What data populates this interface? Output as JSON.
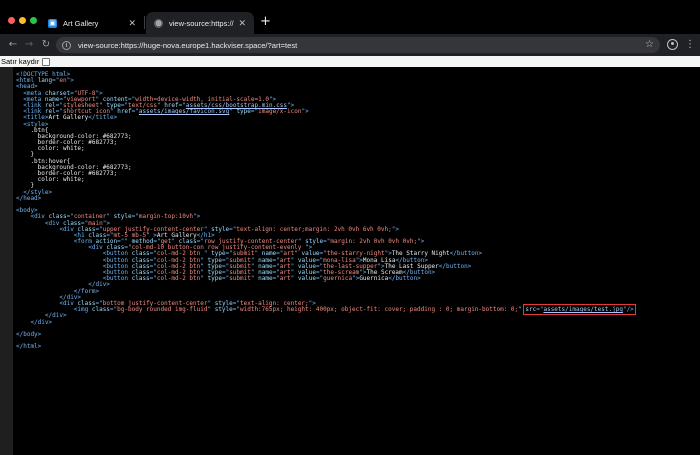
{
  "tabs": [
    {
      "title": "Art Gallery",
      "favicon": "gallery-favicon-icon",
      "close": "✕"
    },
    {
      "title": "view-source:https://huge-nova.europe1.hackviser.space/?art=test",
      "favicon": "globe-icon",
      "close": "✕"
    }
  ],
  "new_tab_label": "+",
  "address_bar": {
    "url": "view-source:https://huge-nova.europe1.hackviser.space/?art=test"
  },
  "line_wrap_label": "Satır kaydır",
  "source_lines": [
    {
      "segs": [
        {
          "c": "t",
          "s": "<!DOCTYPE html>"
        }
      ]
    },
    {
      "segs": [
        {
          "c": "t",
          "s": "<html "
        },
        {
          "c": "a",
          "s": "lang"
        },
        {
          "c": "t",
          "s": "=\""
        },
        {
          "c": "v",
          "s": "en"
        },
        {
          "c": "t",
          "s": "\">"
        }
      ]
    },
    {
      "segs": [
        {
          "c": "t",
          "s": "<head>"
        }
      ]
    },
    {
      "segs": [
        {
          "c": "tx",
          "s": "  "
        },
        {
          "c": "t",
          "s": "<meta "
        },
        {
          "c": "a",
          "s": "charset"
        },
        {
          "c": "t",
          "s": "=\""
        },
        {
          "c": "v",
          "s": "UTF-8"
        },
        {
          "c": "t",
          "s": "\">"
        }
      ]
    },
    {
      "segs": [
        {
          "c": "tx",
          "s": "  "
        },
        {
          "c": "t",
          "s": "<meta "
        },
        {
          "c": "a",
          "s": "name"
        },
        {
          "c": "t",
          "s": "=\""
        },
        {
          "c": "v",
          "s": "viewport"
        },
        {
          "c": "t",
          "s": "\" "
        },
        {
          "c": "a",
          "s": "content"
        },
        {
          "c": "t",
          "s": "=\""
        },
        {
          "c": "v",
          "s": "width=device-width, initial-scale=1.0"
        },
        {
          "c": "t",
          "s": "\">"
        }
      ]
    },
    {
      "segs": [
        {
          "c": "tx",
          "s": "  "
        },
        {
          "c": "t",
          "s": "<link "
        },
        {
          "c": "a",
          "s": "rel"
        },
        {
          "c": "t",
          "s": "=\""
        },
        {
          "c": "v",
          "s": "stylesheet"
        },
        {
          "c": "t",
          "s": "\" "
        },
        {
          "c": "a",
          "s": "type"
        },
        {
          "c": "t",
          "s": "=\""
        },
        {
          "c": "v",
          "s": "text/css"
        },
        {
          "c": "t",
          "s": "\" "
        },
        {
          "c": "a",
          "s": "href"
        },
        {
          "c": "t",
          "s": "=\""
        },
        {
          "c": "lk",
          "s": "assets/css/bootstrap.min.css"
        },
        {
          "c": "t",
          "s": "\">"
        }
      ]
    },
    {
      "segs": [
        {
          "c": "tx",
          "s": "  "
        },
        {
          "c": "t",
          "s": "<link "
        },
        {
          "c": "a",
          "s": "rel"
        },
        {
          "c": "t",
          "s": "=\""
        },
        {
          "c": "v",
          "s": "shortcut icon"
        },
        {
          "c": "t",
          "s": "\" "
        },
        {
          "c": "a",
          "s": "href"
        },
        {
          "c": "t",
          "s": "=\""
        },
        {
          "c": "lk",
          "s": "assets/images/favicon.svg"
        },
        {
          "c": "t",
          "s": "\" "
        },
        {
          "c": "a",
          "s": "type"
        },
        {
          "c": "t",
          "s": "=\""
        },
        {
          "c": "v",
          "s": "image/x-icon"
        },
        {
          "c": "t",
          "s": "\">"
        }
      ]
    },
    {
      "segs": [
        {
          "c": "tx",
          "s": "  "
        },
        {
          "c": "t",
          "s": "<title>"
        },
        {
          "c": "tx",
          "s": "Art Gallery"
        },
        {
          "c": "t",
          "s": "</title>"
        }
      ]
    },
    {
      "segs": [
        {
          "c": "tx",
          "s": "  "
        },
        {
          "c": "t",
          "s": "<style>"
        }
      ]
    },
    {
      "segs": [
        {
          "c": "tx",
          "s": "    .btn{"
        }
      ]
    },
    {
      "segs": [
        {
          "c": "tx",
          "s": "      background-color: #682773;"
        }
      ]
    },
    {
      "segs": [
        {
          "c": "tx",
          "s": "      border-color: #682773;"
        }
      ]
    },
    {
      "segs": [
        {
          "c": "tx",
          "s": "      color: white;"
        }
      ]
    },
    {
      "segs": [
        {
          "c": "tx",
          "s": "    }"
        }
      ]
    },
    {
      "segs": [
        {
          "c": "tx",
          "s": "    .btn:hover{"
        }
      ]
    },
    {
      "segs": [
        {
          "c": "tx",
          "s": "      background-color: #682773;"
        }
      ]
    },
    {
      "segs": [
        {
          "c": "tx",
          "s": "      border-color: #682773;"
        }
      ]
    },
    {
      "segs": [
        {
          "c": "tx",
          "s": "      color: white;"
        }
      ]
    },
    {
      "segs": [
        {
          "c": "tx",
          "s": "    }"
        }
      ]
    },
    {
      "segs": [
        {
          "c": "tx",
          "s": "  "
        },
        {
          "c": "t",
          "s": "</style>"
        }
      ]
    },
    {
      "segs": [
        {
          "c": "t",
          "s": "</head>"
        }
      ]
    },
    {
      "segs": []
    },
    {
      "segs": [
        {
          "c": "t",
          "s": "<body>"
        }
      ]
    },
    {
      "segs": [
        {
          "c": "tx",
          "s": "    "
        },
        {
          "c": "t",
          "s": "<div "
        },
        {
          "c": "a",
          "s": "class"
        },
        {
          "c": "t",
          "s": "=\""
        },
        {
          "c": "v",
          "s": "container"
        },
        {
          "c": "t",
          "s": "\" "
        },
        {
          "c": "a",
          "s": "style"
        },
        {
          "c": "t",
          "s": "=\""
        },
        {
          "c": "v",
          "s": "margin-top:10vh"
        },
        {
          "c": "t",
          "s": "\">"
        }
      ]
    },
    {
      "segs": [
        {
          "c": "tx",
          "s": "        "
        },
        {
          "c": "t",
          "s": "<div "
        },
        {
          "c": "a",
          "s": "class"
        },
        {
          "c": "t",
          "s": "=\""
        },
        {
          "c": "v",
          "s": "main"
        },
        {
          "c": "t",
          "s": "\">"
        }
      ]
    },
    {
      "segs": [
        {
          "c": "tx",
          "s": "            "
        },
        {
          "c": "t",
          "s": "<div "
        },
        {
          "c": "a",
          "s": "class"
        },
        {
          "c": "t",
          "s": "=\""
        },
        {
          "c": "v",
          "s": "upper justify-content-center"
        },
        {
          "c": "t",
          "s": "\" "
        },
        {
          "c": "a",
          "s": "style"
        },
        {
          "c": "t",
          "s": "=\""
        },
        {
          "c": "v",
          "s": "text-align: center;margin: 2vh 0vh 6vh 0vh;"
        },
        {
          "c": "t",
          "s": "\">"
        }
      ]
    },
    {
      "segs": [
        {
          "c": "tx",
          "s": "                "
        },
        {
          "c": "t",
          "s": "<h1 "
        },
        {
          "c": "a",
          "s": "class"
        },
        {
          "c": "t",
          "s": "=\""
        },
        {
          "c": "v",
          "s": "mt-5 mb-5"
        },
        {
          "c": "t",
          "s": "\" >"
        },
        {
          "c": "tx",
          "s": "Art Gallery"
        },
        {
          "c": "t",
          "s": "</h1>"
        }
      ]
    },
    {
      "segs": [
        {
          "c": "tx",
          "s": "                "
        },
        {
          "c": "t",
          "s": "<form "
        },
        {
          "c": "a",
          "s": "action"
        },
        {
          "c": "t",
          "s": "=\""
        },
        {
          "c": "v",
          "s": ""
        },
        {
          "c": "t",
          "s": "\" "
        },
        {
          "c": "a",
          "s": "method"
        },
        {
          "c": "t",
          "s": "=\""
        },
        {
          "c": "v",
          "s": "get"
        },
        {
          "c": "t",
          "s": "\" "
        },
        {
          "c": "a",
          "s": "class"
        },
        {
          "c": "t",
          "s": "=\""
        },
        {
          "c": "v",
          "s": "row justify-content-center"
        },
        {
          "c": "t",
          "s": "\" "
        },
        {
          "c": "a",
          "s": "style"
        },
        {
          "c": "t",
          "s": "=\""
        },
        {
          "c": "v",
          "s": "margin: 2vh 0vh 0vh 0vh;"
        },
        {
          "c": "t",
          "s": "\">"
        }
      ]
    },
    {
      "segs": [
        {
          "c": "tx",
          "s": "                    "
        },
        {
          "c": "t",
          "s": "<div "
        },
        {
          "c": "a",
          "s": "class"
        },
        {
          "c": "t",
          "s": "=\""
        },
        {
          "c": "v",
          "s": "col-md-10 button-con row justify-content-evenly "
        },
        {
          "c": "t",
          "s": "\">"
        }
      ]
    },
    {
      "segs": [
        {
          "c": "tx",
          "s": "                        "
        },
        {
          "c": "t",
          "s": "<button "
        },
        {
          "c": "a",
          "s": "class"
        },
        {
          "c": "t",
          "s": "=\""
        },
        {
          "c": "v",
          "s": "col-md-2 btn "
        },
        {
          "c": "t",
          "s": "\" "
        },
        {
          "c": "a",
          "s": "type"
        },
        {
          "c": "t",
          "s": "=\""
        },
        {
          "c": "v",
          "s": "submit"
        },
        {
          "c": "t",
          "s": "\" "
        },
        {
          "c": "a",
          "s": "name"
        },
        {
          "c": "t",
          "s": "=\""
        },
        {
          "c": "v",
          "s": "art"
        },
        {
          "c": "t",
          "s": "\" "
        },
        {
          "c": "a",
          "s": "value"
        },
        {
          "c": "t",
          "s": "=\""
        },
        {
          "c": "v",
          "s": "the-starry-night"
        },
        {
          "c": "t",
          "s": "\">"
        },
        {
          "c": "tx",
          "s": "The Starry Night"
        },
        {
          "c": "t",
          "s": "</button>"
        }
      ]
    },
    {
      "segs": [
        {
          "c": "tx",
          "s": "                        "
        },
        {
          "c": "t",
          "s": "<button "
        },
        {
          "c": "a",
          "s": "class"
        },
        {
          "c": "t",
          "s": "=\""
        },
        {
          "c": "v",
          "s": "col-md-2 btn"
        },
        {
          "c": "t",
          "s": "\" "
        },
        {
          "c": "a",
          "s": "type"
        },
        {
          "c": "t",
          "s": "=\""
        },
        {
          "c": "v",
          "s": "submit"
        },
        {
          "c": "t",
          "s": "\" "
        },
        {
          "c": "a",
          "s": "name"
        },
        {
          "c": "t",
          "s": "=\""
        },
        {
          "c": "v",
          "s": "art"
        },
        {
          "c": "t",
          "s": "\" "
        },
        {
          "c": "a",
          "s": "value"
        },
        {
          "c": "t",
          "s": "=\""
        },
        {
          "c": "v",
          "s": "mona-lisa"
        },
        {
          "c": "t",
          "s": "\">"
        },
        {
          "c": "tx",
          "s": "Mona Lisa"
        },
        {
          "c": "t",
          "s": "</button>"
        }
      ]
    },
    {
      "segs": [
        {
          "c": "tx",
          "s": "                        "
        },
        {
          "c": "t",
          "s": "<button "
        },
        {
          "c": "a",
          "s": "class"
        },
        {
          "c": "t",
          "s": "=\""
        },
        {
          "c": "v",
          "s": "col-md-2 btn"
        },
        {
          "c": "t",
          "s": "\" "
        },
        {
          "c": "a",
          "s": "type"
        },
        {
          "c": "t",
          "s": "=\""
        },
        {
          "c": "v",
          "s": "submit"
        },
        {
          "c": "t",
          "s": "\" "
        },
        {
          "c": "a",
          "s": "name"
        },
        {
          "c": "t",
          "s": "=\""
        },
        {
          "c": "v",
          "s": "art"
        },
        {
          "c": "t",
          "s": "\" "
        },
        {
          "c": "a",
          "s": "value"
        },
        {
          "c": "t",
          "s": "=\""
        },
        {
          "c": "v",
          "s": "the-last-supper"
        },
        {
          "c": "t",
          "s": "\">"
        },
        {
          "c": "tx",
          "s": "The Last Supper"
        },
        {
          "c": "t",
          "s": "</button>"
        }
      ]
    },
    {
      "segs": [
        {
          "c": "tx",
          "s": "                        "
        },
        {
          "c": "t",
          "s": "<button "
        },
        {
          "c": "a",
          "s": "class"
        },
        {
          "c": "t",
          "s": "=\""
        },
        {
          "c": "v",
          "s": "col-md-2 btn"
        },
        {
          "c": "t",
          "s": "\" "
        },
        {
          "c": "a",
          "s": "type"
        },
        {
          "c": "t",
          "s": "=\""
        },
        {
          "c": "v",
          "s": "submit"
        },
        {
          "c": "t",
          "s": "\" "
        },
        {
          "c": "a",
          "s": "name"
        },
        {
          "c": "t",
          "s": "=\""
        },
        {
          "c": "v",
          "s": "art"
        },
        {
          "c": "t",
          "s": "\" "
        },
        {
          "c": "a",
          "s": "value"
        },
        {
          "c": "t",
          "s": "=\""
        },
        {
          "c": "v",
          "s": "the-scream"
        },
        {
          "c": "t",
          "s": "\">"
        },
        {
          "c": "tx",
          "s": "The Scream"
        },
        {
          "c": "t",
          "s": "</button>"
        }
      ]
    },
    {
      "segs": [
        {
          "c": "tx",
          "s": "                        "
        },
        {
          "c": "t",
          "s": "<button "
        },
        {
          "c": "a",
          "s": "class"
        },
        {
          "c": "t",
          "s": "=\""
        },
        {
          "c": "v",
          "s": "col-md-2 btn"
        },
        {
          "c": "t",
          "s": "\" "
        },
        {
          "c": "a",
          "s": "type"
        },
        {
          "c": "t",
          "s": "=\""
        },
        {
          "c": "v",
          "s": "submit"
        },
        {
          "c": "t",
          "s": "\" "
        },
        {
          "c": "a",
          "s": "name"
        },
        {
          "c": "t",
          "s": "=\""
        },
        {
          "c": "v",
          "s": "art"
        },
        {
          "c": "t",
          "s": "\" "
        },
        {
          "c": "a",
          "s": "value"
        },
        {
          "c": "t",
          "s": "=\""
        },
        {
          "c": "v",
          "s": "guernica"
        },
        {
          "c": "t",
          "s": "\">"
        },
        {
          "c": "tx",
          "s": "Guernica"
        },
        {
          "c": "t",
          "s": "</button>"
        }
      ]
    },
    {
      "segs": [
        {
          "c": "tx",
          "s": "                    "
        },
        {
          "c": "t",
          "s": "</div>"
        }
      ]
    },
    {
      "segs": [
        {
          "c": "tx",
          "s": "                "
        },
        {
          "c": "t",
          "s": "</form>"
        }
      ]
    },
    {
      "segs": [
        {
          "c": "tx",
          "s": "            "
        },
        {
          "c": "t",
          "s": "</div>"
        }
      ]
    },
    {
      "segs": [
        {
          "c": "tx",
          "s": "            "
        },
        {
          "c": "t",
          "s": "<div "
        },
        {
          "c": "a",
          "s": "class"
        },
        {
          "c": "t",
          "s": "=\""
        },
        {
          "c": "v",
          "s": "bottom justify-content-center"
        },
        {
          "c": "t",
          "s": "\" "
        },
        {
          "c": "a",
          "s": "style"
        },
        {
          "c": "t",
          "s": "=\""
        },
        {
          "c": "v",
          "s": "text-align: center;"
        },
        {
          "c": "t",
          "s": "\">"
        }
      ]
    },
    {
      "segs": [
        {
          "c": "tx",
          "s": "                "
        },
        {
          "c": "t",
          "s": "<img "
        },
        {
          "c": "a",
          "s": "class"
        },
        {
          "c": "t",
          "s": "=\""
        },
        {
          "c": "v",
          "s": "bg-body rounded img-fluid"
        },
        {
          "c": "t",
          "s": "\" "
        },
        {
          "c": "a",
          "s": "style"
        },
        {
          "c": "t",
          "s": "=\""
        },
        {
          "c": "v",
          "s": "width:765px; height: 400px; object-fit: cover; padding : 0; margin-bottom: 0;"
        },
        {
          "c": "t",
          "s": "\" "
        },
        {
          "c": "a",
          "s": "src"
        },
        {
          "c": "t",
          "s": "=\""
        },
        {
          "c": "lk",
          "s": "assets/images/test.jpg"
        },
        {
          "c": "t",
          "s": "\"/>"
        },
        {
          "c": "tx",
          "s": "                    "
        },
        {
          "c": "t",
          "s": "</div>"
        }
      ]
    },
    {
      "segs": [
        {
          "c": "tx",
          "s": "        "
        },
        {
          "c": "t",
          "s": "</div>"
        }
      ]
    },
    {
      "segs": [
        {
          "c": "tx",
          "s": "    "
        },
        {
          "c": "t",
          "s": "</div>"
        }
      ]
    },
    {
      "segs": []
    },
    {
      "segs": [
        {
          "c": "t",
          "s": "</body>"
        }
      ]
    },
    {
      "segs": []
    },
    {
      "segs": [
        {
          "c": "t",
          "s": "</html>"
        }
      ]
    }
  ],
  "highlight_color": "#e53935"
}
